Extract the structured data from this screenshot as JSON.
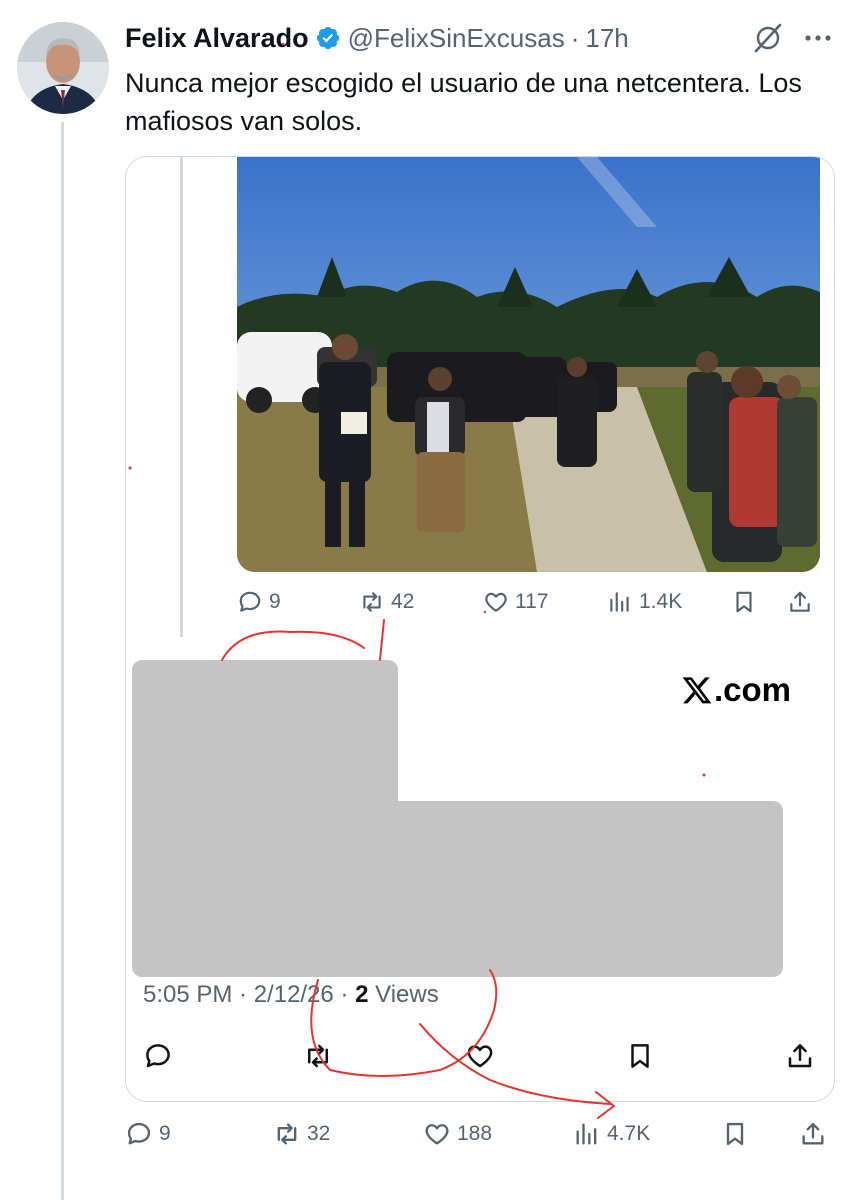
{
  "colors": {
    "verified": "#1d9bf0",
    "text": "#0f1419",
    "secondary": "#536471",
    "annotation": "#e8332a",
    "redaction": "#c4c4c4"
  },
  "tweet": {
    "author_name": "Felix Alvarado",
    "handle": "@FelixSinExcusas",
    "separator": "·",
    "time": "17h",
    "text": "Nunca mejor escogido el usuario de una netcentera. Los mafiosos van solos.",
    "icons": {
      "verified": "verified-badge-icon",
      "grok": "grok-icon",
      "more": "more-icon"
    }
  },
  "quoted": {
    "inner_actions": {
      "replies": "9",
      "reposts": "42",
      "likes": "117",
      "views": "1.4K"
    },
    "brand": ".com",
    "meta": {
      "datetime": "5:05 PM · 2/12/26 · ",
      "views_count": "2",
      "views_label": " Views"
    }
  },
  "actions": {
    "replies": "9",
    "reposts": "32",
    "likes": "188",
    "views": "4.7K"
  }
}
